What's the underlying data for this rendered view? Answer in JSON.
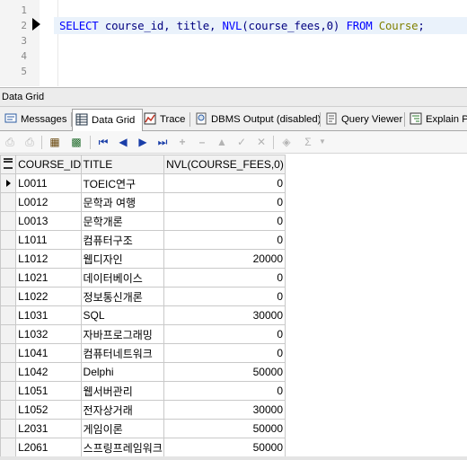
{
  "editor": {
    "line_numbers": [
      "1",
      "2",
      "3",
      "4",
      "5"
    ],
    "sql_tokens": [
      {
        "text": "SELECT ",
        "class": "kw"
      },
      {
        "text": "course_id, title, ",
        "class": "plain"
      },
      {
        "text": "NVL",
        "class": "kw"
      },
      {
        "text": "(course_fees,0) ",
        "class": "plain"
      },
      {
        "text": "FROM ",
        "class": "kw"
      },
      {
        "text": "Course",
        "class": "tbl"
      },
      {
        "text": ";",
        "class": "plain"
      }
    ]
  },
  "panel": {
    "title": "Data Grid"
  },
  "tabs": [
    {
      "label": "Messages",
      "icon": "messages-icon"
    },
    {
      "label": "Data Grid",
      "icon": "data-grid-icon"
    },
    {
      "label": "Trace",
      "icon": "trace-icon"
    },
    {
      "label": "DBMS Output (disabled)",
      "icon": "dbms-output-icon"
    },
    {
      "label": "Query Viewer",
      "icon": "query-viewer-icon"
    },
    {
      "label": "Explain Pl",
      "icon": "explain-plan-icon"
    }
  ],
  "grid": {
    "columns": [
      "COURSE_ID",
      "TITLE",
      "NVL(COURSE_FEES,0)"
    ],
    "rows": [
      [
        "L0011",
        "TOEIC연구",
        "0"
      ],
      [
        "L0012",
        "문학과 여행",
        "0"
      ],
      [
        "L0013",
        "문학개론",
        "0"
      ],
      [
        "L1011",
        "컴퓨터구조",
        "0"
      ],
      [
        "L1012",
        "웹디자인",
        "20000"
      ],
      [
        "L1021",
        "데이터베이스",
        "0"
      ],
      [
        "L1022",
        "정보통신개론",
        "0"
      ],
      [
        "L1031",
        "SQL",
        "30000"
      ],
      [
        "L1032",
        "자바프로그래밍",
        "0"
      ],
      [
        "L1041",
        "컴퓨터네트워크",
        "0"
      ],
      [
        "L1042",
        "Delphi",
        "50000"
      ],
      [
        "L1051",
        "웹서버관리",
        "0"
      ],
      [
        "L1052",
        "전자상거래",
        "30000"
      ],
      [
        "L2031",
        "게임이론",
        "50000"
      ],
      [
        "L2061",
        "스프링프레임워크",
        "50000"
      ]
    ]
  },
  "colors": {
    "keyword": "#0000ff",
    "identifier": "#000080",
    "table_name": "#808000"
  }
}
